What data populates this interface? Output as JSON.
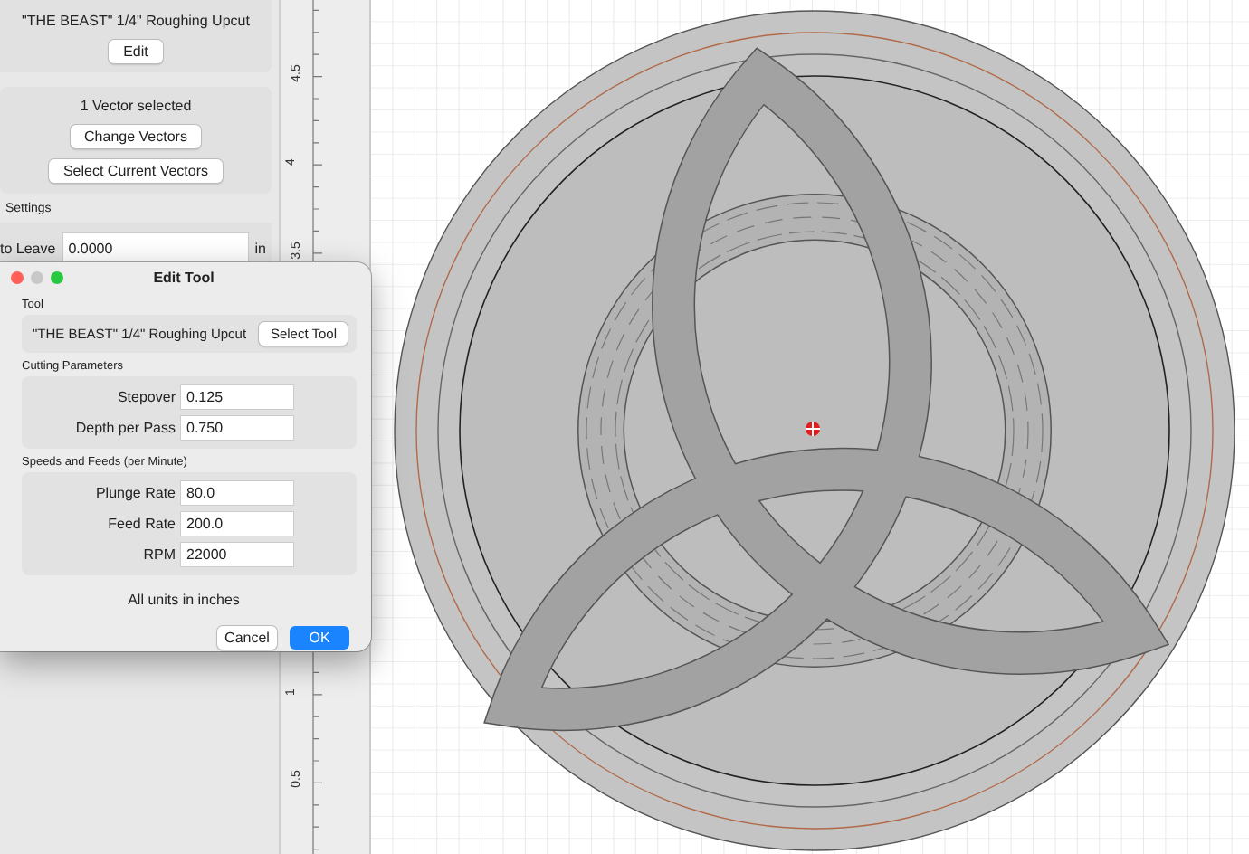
{
  "side_panel": {
    "tool_name": "\"THE BEAST\" 1/4\" Roughing Upcut",
    "edit_button": "Edit",
    "vector_status": "1 Vector selected",
    "change_vectors_button": "Change Vectors",
    "select_vectors_button": "Select Current Vectors",
    "settings_heading": "Settings",
    "field": {
      "label": "to Leave",
      "value": "0.0000",
      "unit": "in"
    }
  },
  "ruler": {
    "labels": [
      "4.5",
      "4",
      "3.5",
      "1",
      "0.5"
    ]
  },
  "dialog": {
    "title": "Edit Tool",
    "sections": [
      {
        "kind": "tool",
        "heading": "Tool",
        "tool_name": "\"THE BEAST\" 1/4\" Roughing Upcut",
        "button": "Select Tool"
      },
      {
        "kind": "fields",
        "heading": "Cutting Parameters",
        "fields": [
          {
            "label": "Stepover",
            "value": "0.125"
          },
          {
            "label": "Depth per Pass",
            "value": "0.750"
          }
        ]
      },
      {
        "kind": "fields",
        "heading": "Speeds and Feeds (per Minute)",
        "fields": [
          {
            "label": "Plunge Rate",
            "value": "80.0"
          },
          {
            "label": "Feed Rate",
            "value": "200.0"
          },
          {
            "label": "RPM",
            "value": "22000"
          }
        ]
      }
    ],
    "note": "All units in inches",
    "buttons": [
      {
        "label": "Cancel",
        "default": false
      },
      {
        "label": "OK",
        "default": true
      }
    ]
  }
}
